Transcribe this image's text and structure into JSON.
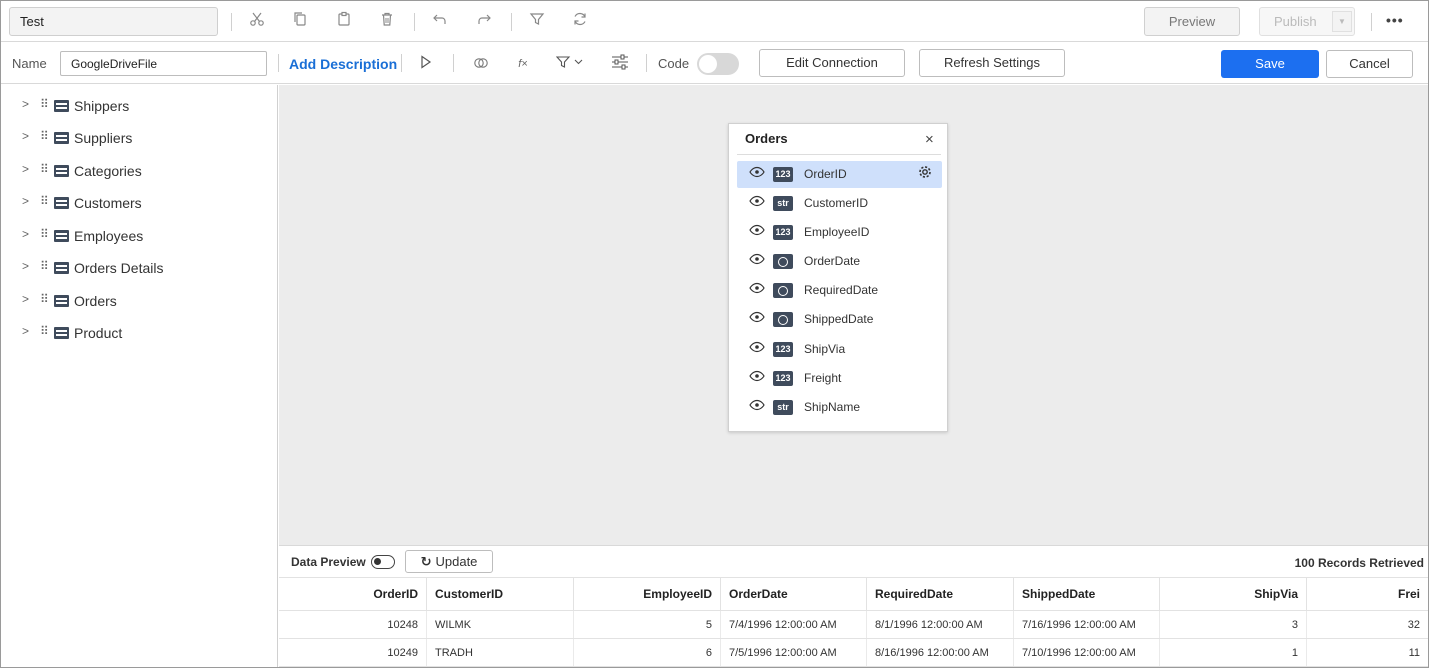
{
  "toolbar": {
    "title_value": "Test",
    "icons": [
      "cut-icon",
      "copy-icon",
      "paste-icon",
      "delete-icon",
      "undo-icon",
      "redo-icon",
      "filter-icon",
      "refresh-icon"
    ],
    "preview_label": "Preview",
    "publish_label": "Publish",
    "more_label": "•••"
  },
  "secondary": {
    "name_label": "Name",
    "name_value": "GoogleDriveFile",
    "add_description_label": "Add Description",
    "fx_label": "f×",
    "code_label": "Code",
    "code_toggle_on": false,
    "edit_connection_label": "Edit Connection",
    "refresh_settings_label": "Refresh Settings",
    "save_label": "Save",
    "cancel_label": "Cancel",
    "accent_color": "#1c6ff0"
  },
  "tree": {
    "items": [
      {
        "label": "Shippers"
      },
      {
        "label": "Suppliers"
      },
      {
        "label": "Categories"
      },
      {
        "label": "Customers"
      },
      {
        "label": "Employees"
      },
      {
        "label": "Orders Details"
      },
      {
        "label": "Orders"
      },
      {
        "label": "Product"
      }
    ]
  },
  "table_card": {
    "title": "Orders",
    "close_label": "×",
    "fields": [
      {
        "name": "OrderID",
        "type": "123",
        "selected": true
      },
      {
        "name": "CustomerID",
        "type": "str"
      },
      {
        "name": "EmployeeID",
        "type": "123"
      },
      {
        "name": "OrderDate",
        "type": "date"
      },
      {
        "name": "RequiredDate",
        "type": "date"
      },
      {
        "name": "ShippedDate",
        "type": "date"
      },
      {
        "name": "ShipVia",
        "type": "123"
      },
      {
        "name": "Freight",
        "type": "123"
      },
      {
        "name": "ShipName",
        "type": "str"
      }
    ]
  },
  "data_preview": {
    "label": "Data Preview",
    "update_label": "Update",
    "records_label": "100 Records Retrieved",
    "columns": [
      "OrderID",
      "CustomerID",
      "EmployeeID",
      "OrderDate",
      "RequiredDate",
      "ShippedDate",
      "ShipVia",
      "Frei"
    ],
    "rows": [
      [
        "10248",
        "WILMK",
        "5",
        "7/4/1996 12:00:00 AM",
        "8/1/1996 12:00:00 AM",
        "7/16/1996 12:00:00 AM",
        "3",
        "32"
      ],
      [
        "10249",
        "TRADH",
        "6",
        "7/5/1996 12:00:00 AM",
        "8/16/1996 12:00:00 AM",
        "7/10/1996 12:00:00 AM",
        "1",
        "11"
      ]
    ]
  }
}
